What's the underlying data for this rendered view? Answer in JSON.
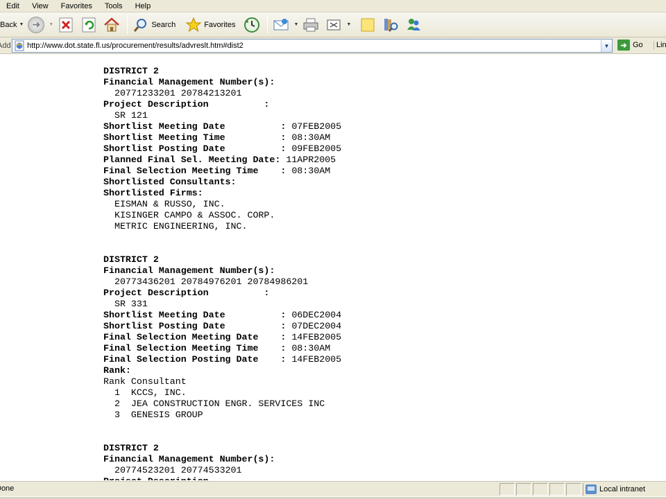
{
  "menu": [
    "Edit",
    "View",
    "Favorites",
    "Tools",
    "Help"
  ],
  "toolbar": {
    "back_label": "Back",
    "search_label": "Search",
    "favorites_label": "Favorites"
  },
  "address": {
    "label": "Address",
    "url": "http://www.dot.state.fl.us/procurement/results/advreslt.htm#dist2",
    "go_label": "Go",
    "links_label": "Links"
  },
  "content": {
    "lines": [
      {
        "text": "DISTRICT 2",
        "bold": true
      },
      {
        "text": "Financial Management Number(s):",
        "bold": true
      },
      {
        "text": "  20771233201 20784213201",
        "bold": false
      },
      {
        "text": "Project Description          :",
        "bold": true
      },
      {
        "text": "  SR 121",
        "bold": false
      },
      {
        "text": "Shortlist Meeting Date          : ",
        "bold": true,
        "value": "07FEB2005"
      },
      {
        "text": "Shortlist Meeting Time          : ",
        "bold": true,
        "value": "08:30AM"
      },
      {
        "text": "Shortlist Posting Date          : ",
        "bold": true,
        "value": "09FEB2005"
      },
      {
        "text": "Planned Final Sel. Meeting Date: ",
        "bold": true,
        "value": "11APR2005"
      },
      {
        "text": "Final Selection Meeting Time    : ",
        "bold": true,
        "value": "08:30AM"
      },
      {
        "text": "Shortlisted Consultants:",
        "bold": true
      },
      {
        "text": "Shortlisted Firms:",
        "bold": true
      },
      {
        "text": "  EISMAN & RUSSO, INC.",
        "bold": false
      },
      {
        "text": "  KISINGER CAMPO & ASSOC. CORP.",
        "bold": false
      },
      {
        "text": "  METRIC ENGINEERING, INC.",
        "bold": false
      },
      {
        "text": "",
        "bold": false
      },
      {
        "text": "",
        "bold": false
      },
      {
        "text": "DISTRICT 2",
        "bold": true
      },
      {
        "text": "Financial Management Number(s):",
        "bold": true
      },
      {
        "text": "  20773436201 20784976201 20784986201",
        "bold": false
      },
      {
        "text": "Project Description          :",
        "bold": true
      },
      {
        "text": "  SR 331",
        "bold": false
      },
      {
        "text": "Shortlist Meeting Date          : ",
        "bold": true,
        "value": "06DEC2004"
      },
      {
        "text": "Shortlist Posting Date          : ",
        "bold": true,
        "value": "07DEC2004"
      },
      {
        "text": "Final Selection Meeting Date    : ",
        "bold": true,
        "value": "14FEB2005"
      },
      {
        "text": "Final Selection Meeting Time    : ",
        "bold": true,
        "value": "08:30AM"
      },
      {
        "text": "Final Selection Posting Date    : ",
        "bold": true,
        "value": "14FEB2005"
      },
      {
        "text": "Rank:",
        "bold": true
      },
      {
        "text": "Rank Consultant",
        "bold": false
      },
      {
        "text": "  1  KCCS, INC.",
        "bold": false
      },
      {
        "text": "  2  JEA CONSTRUCTION ENGR. SERVICES INC",
        "bold": false
      },
      {
        "text": "  3  GENESIS GROUP",
        "bold": false
      },
      {
        "text": "",
        "bold": false
      },
      {
        "text": "",
        "bold": false
      },
      {
        "text": "DISTRICT 2",
        "bold": true
      },
      {
        "text": "Financial Management Number(s):",
        "bold": true
      },
      {
        "text": "  20774523201 20774533201",
        "bold": false
      },
      {
        "text": "Project Description",
        "bold": true
      }
    ]
  },
  "status": {
    "text": "Done",
    "zone": "Local intranet"
  }
}
